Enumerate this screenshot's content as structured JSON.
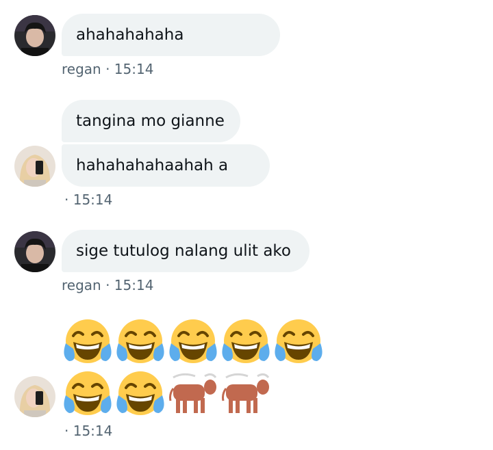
{
  "messages": [
    {
      "text": "ahahahahaha",
      "sender": "regan",
      "time": "15:14"
    },
    {
      "text": "tangina mo gianne"
    },
    {
      "text": "hahahahahaahah a",
      "time": "15:14"
    },
    {
      "text": "sige tutulog nalang ulit ako",
      "sender": "regan",
      "time": "15:14"
    },
    {
      "emojis": [
        "face-with-tears-of-joy",
        "face-with-tears-of-joy",
        "face-with-tears-of-joy",
        "face-with-tears-of-joy",
        "face-with-tears-of-joy",
        "face-with-tears-of-joy",
        "face-with-tears-of-joy",
        "ox",
        "ox"
      ],
      "time": "15:14"
    }
  ],
  "meta": {
    "m1": "regan · 15:14",
    "m3": "· 15:14",
    "m4": "regan · 15:14",
    "m5": "· 15:14"
  },
  "colors": {
    "bubble_bg": "#eff3f4",
    "meta_text": "#536471",
    "emoji_face": "#ffcc4d",
    "emoji_tear": "#5dadec",
    "ox": "#c1694f"
  }
}
